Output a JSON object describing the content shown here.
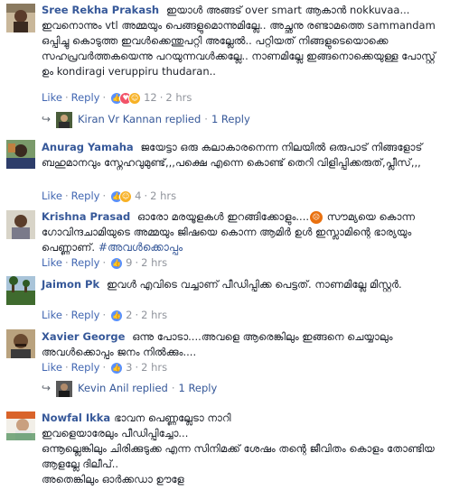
{
  "comments": [
    {
      "author": "Sree Rekha Prakash",
      "text": "ഇയാള്‍ അങ്ങട് over smart ആകാന്‍ nokkuvaa... ഇവനൊന്നും vtl അമ്മയും പെങ്ങളുമൊന്നുമില്ലേ.. അച്ഛനു രണ്ടാമത്തെ sammandam ഒപ്പിച്ചു കൊടുത്ത ഇവള്‍ക്കെന്തുപറ്റി അല്ലേൽ.. പറ്റിയത് നിങ്ങളുടെയൊക്കെ സഹപ്രവര്‍ത്തകയെന്നു പറയുന്നവള്‍ക്കല്ലേ.. നാണമില്ലേ ഇങ്ങനൊക്കെയുള്ള പോസ്റ്റ്‌ ഉം kondiragi veruppiru thudaran..",
      "like": "Like",
      "reply": "Reply",
      "reaction_count": "12",
      "time": "2 hrs"
    },
    {
      "author": "Anurag Yamaha",
      "text": "ജയേട്ടാ ഒരു കലാകാരനെന്ന നിലയിൽ ഒരുപാട് നിങ്ങളോട് ബഹുമാനവും സ്നേഹവുമുണ്ട്,,,പക്ഷെ എന്നെ കൊണ്ട് തെറി വിളിപ്പിക്കരുത്,പ്ലീസ്,,,",
      "like": "Like",
      "reply": "Reply",
      "reaction_count": "4",
      "time": "2 hrs"
    },
    {
      "author": "Krishna Prasad",
      "text": "ഓരോ മരയൂളകൾ ഇറങ്ങിക്കോളും....",
      "text2": "സൗമ്യയെ കൊന്ന ഗോവിന്ദചാമിയുടെ അമ്മയും ജിഷയെ കൊന്ന ആമിർ ഉൾ ഇസ്ലാമിന്റെ ഭാര്യയും പെണ്ണാണ്.",
      "hashtag": "#അവൾക്കൊപ്പം",
      "like": "Like",
      "reply": "Reply",
      "reaction_count": "9",
      "time": "2 hrs"
    },
    {
      "author": "Jaimon Pk",
      "text": "ഇവൾ എവിടെ വച്ചാണ് പീഡിപ്പിക്ക പെട്ടത്. നാണമില്ലേ മിസ്റ്റർ.",
      "like": "Like",
      "reply": "Reply",
      "reaction_count": "2",
      "time": "2 hrs"
    },
    {
      "author": "Xavier George",
      "text": "ഒന്നു പോടാ....അവളെ ആരെങ്കിലും ഇങ്ങനെ ചെയ്യാലും അവൾക്കൊപ്പം ജനം നിൽക്കും....",
      "like": "Like",
      "reply": "Reply",
      "reaction_count": "3",
      "time": "2 hrs"
    },
    {
      "author": "Nowfal Ikka",
      "line1": "ഭാവന പെണ്ണല്ലേടാ നാറി",
      "line2": "ഇവളെയാരേലും പീഡിപ്പിച്ചോ...",
      "line3": "ഒന്നൂല്ലെങ്കിലും ചിരിക്കുടുക്ക എന്ന സിനിമക്ക് ശേഷം തന്റെ ജീവിതം കൊളം തോണ്ടിയ ആളല്ലേ ദിലീപ്..",
      "line4": "അതെങ്കിലും ഓർക്കഡാ ഊളേ"
    }
  ],
  "replies": [
    {
      "name": "Kiran Vr Kannan",
      "replied": "replied",
      "count": "1 Reply"
    },
    {
      "name": "Kevin Anil",
      "replied": "replied",
      "count": "1 Reply"
    }
  ],
  "icons": {
    "like": "like-reaction-icon",
    "love": "love-reaction-icon",
    "haha": "haha-reaction-icon",
    "angry": "angry-reaction-icon",
    "reply_arrow": "reply-arrow-icon"
  },
  "colors": {
    "link": "#365899",
    "action": "#4267b2",
    "meta": "#90949c"
  }
}
